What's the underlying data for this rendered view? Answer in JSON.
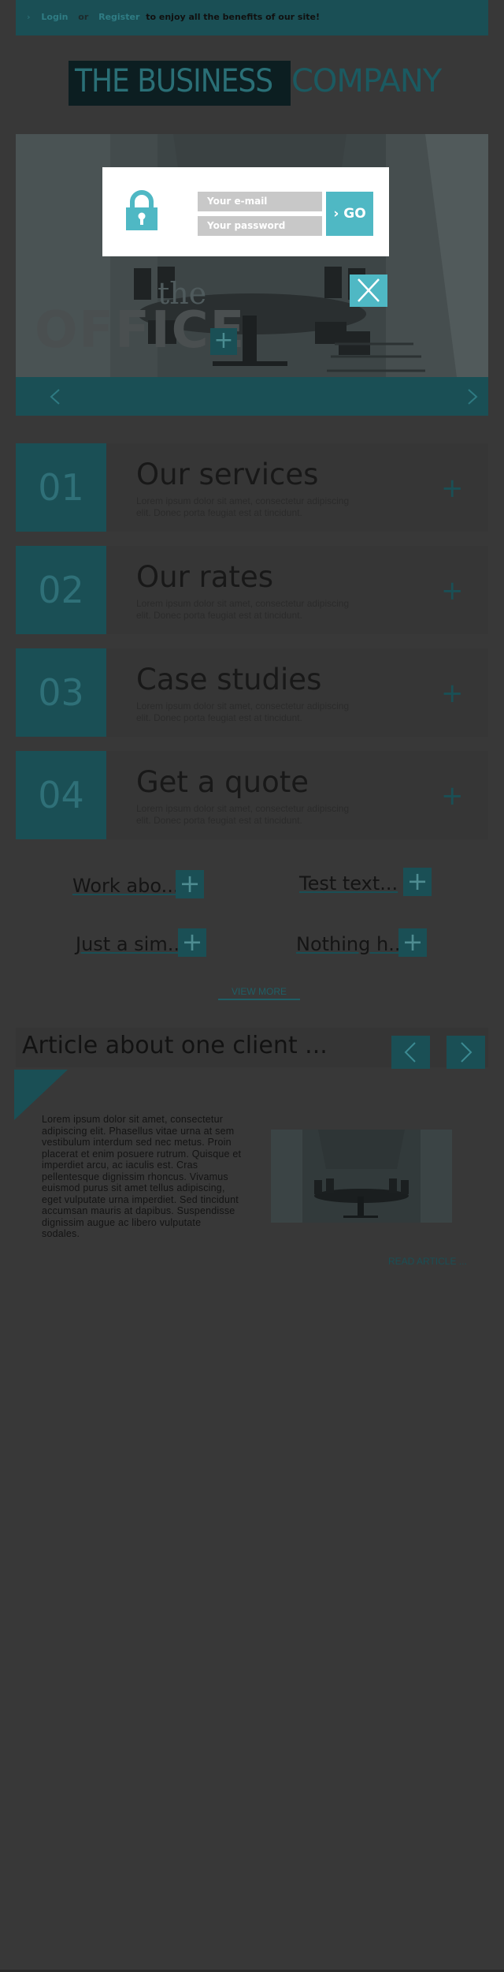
{
  "topbar": {
    "arrow": "›",
    "login_label": "Login",
    "or_label": "or",
    "register_label": "Register",
    "message": "to enjoy all the benefits of our site!"
  },
  "logo": {
    "part1": "THE BUSINESS",
    "part2": "COMPANY"
  },
  "hero": {
    "script_word": "the",
    "headline": "OFFICE",
    "plus": "+"
  },
  "login_modal": {
    "email_placeholder": "Your e-mail",
    "password_placeholder": "Your password",
    "go_label": "› GO"
  },
  "services": [
    {
      "number": "01",
      "title": "Our services",
      "description": "Lorem ipsum dolor sit amet, consectetur adipiscing elit. Donec porta feugiat est at tincidunt."
    },
    {
      "number": "02",
      "title": "Our rates",
      "description": "Lorem ipsum dolor sit amet, consectetur adipiscing elit. Donec porta feugiat est at tincidunt."
    },
    {
      "number": "03",
      "title": "Case studies",
      "description": "Lorem ipsum dolor sit amet, consectetur adipiscing elit. Donec porta feugiat est at tincidunt."
    },
    {
      "number": "04",
      "title": "Get a quote",
      "description": "Lorem ipsum dolor sit amet, consectetur adipiscing elit. Donec porta feugiat est at tincidunt."
    }
  ],
  "work_tiles": [
    {
      "label": "Work abo..."
    },
    {
      "label": "Test text..."
    },
    {
      "label": "Just a sim..."
    },
    {
      "label": "Nothing h..."
    }
  ],
  "plus_symbol": "+",
  "view_more": "VIEW MORE",
  "article": {
    "title": "Article about one client ...",
    "body": "Lorem ipsum dolor sit amet, consectetur adipiscing elit. Phasellus vitae urna at sem vestibulum interdum sed nec metus. Proin placerat et enim posuere rutrum. Quisque et imperdiet arcu, ac iaculis est. Cras pellentesque dignissim rhoncus. Vivamus euismod purus sit amet tellus adipiscing, eget vulputate urna imperdiet. Sed tincidunt accumsan mauris at dapibus. Suspendisse dignissim augue ac libero vulputate sodales.",
    "read_more": "READ ARTICLE ..."
  },
  "colors": {
    "background": "#383838",
    "teal_dark": "#1a4f55",
    "teal_accent": "#4fb8c4",
    "modal_bg": "#ffffff",
    "field_bg": "#c8c8c8"
  },
  "icons": [
    "chevron-right-icon",
    "lock-icon",
    "close-icon",
    "arrow-left-icon",
    "arrow-right-icon",
    "plus-icon"
  ]
}
